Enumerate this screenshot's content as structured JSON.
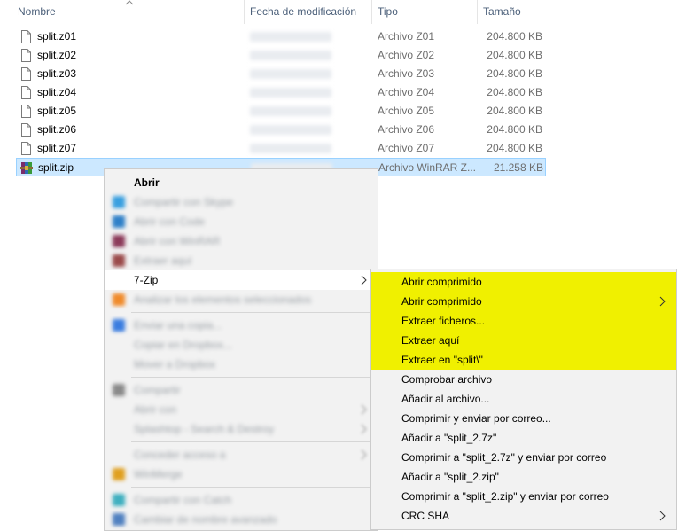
{
  "columns": {
    "name": "Nombre",
    "date": "Fecha de modificación",
    "type": "Tipo",
    "size": "Tamaño"
  },
  "files": [
    {
      "name": "split.z01",
      "type": "Archivo Z01",
      "size": "204.800 KB",
      "icon": "document-icon"
    },
    {
      "name": "split.z02",
      "type": "Archivo Z02",
      "size": "204.800 KB",
      "icon": "document-icon"
    },
    {
      "name": "split.z03",
      "type": "Archivo Z03",
      "size": "204.800 KB",
      "icon": "document-icon"
    },
    {
      "name": "split.z04",
      "type": "Archivo Z04",
      "size": "204.800 KB",
      "icon": "document-icon"
    },
    {
      "name": "split.z05",
      "type": "Archivo Z05",
      "size": "204.800 KB",
      "icon": "document-icon"
    },
    {
      "name": "split.z06",
      "type": "Archivo Z06",
      "size": "204.800 KB",
      "icon": "document-icon"
    },
    {
      "name": "split.z07",
      "type": "Archivo Z07",
      "size": "204.800 KB",
      "icon": "document-icon"
    },
    {
      "name": "split.zip",
      "type": "Archivo WinRAR Z...",
      "size": "21.258 KB",
      "icon": "winrar-archive-icon",
      "selected": true
    }
  ],
  "context_menu": {
    "open": "Abrir",
    "blurred": [
      "Compartir con Skype",
      "Abrir con Code",
      "Abrir con WinRAR",
      "Extraer aquí"
    ],
    "seven_zip": "7-Zip",
    "blurred_after": [
      "Analizar los elementos seleccionados",
      "Enviar una copia...",
      "Copiar en Dropbox...",
      "Mover a Dropbox",
      "Compartir",
      "Abrir con",
      "Splashtop - Search & Destroy",
      "Conceder acceso a",
      "WinMerge",
      "Compartir con Catch",
      "Cambiar de nombre avanzado"
    ]
  },
  "submenu": {
    "items": [
      {
        "label": "Abrir comprimido",
        "highlight": true
      },
      {
        "label": "Abrir comprimido",
        "highlight": true,
        "submenu": true
      },
      {
        "label": "Extraer ficheros...",
        "highlight": true
      },
      {
        "label": "Extraer aquí",
        "highlight": true
      },
      {
        "label": "Extraer en \"split\\\"",
        "highlight": true
      },
      {
        "label": "Comprobar archivo"
      },
      {
        "label": "Añadir al archivo..."
      },
      {
        "label": "Comprimir y enviar por correo..."
      },
      {
        "label": "Añadir a \"split_2.7z\""
      },
      {
        "label": "Comprimir a \"split_2.7z\" y enviar por correo"
      },
      {
        "label": "Añadir a \"split_2.zip\""
      },
      {
        "label": "Comprimir a \"split_2.zip\" y enviar por correo"
      },
      {
        "label": "CRC SHA",
        "submenu": true
      }
    ],
    "highlight_color": "#f0f000"
  },
  "colors": {
    "selection": "#cce8ff",
    "header_text": "#4c607a",
    "menu_bg": "#f2f2f2"
  }
}
